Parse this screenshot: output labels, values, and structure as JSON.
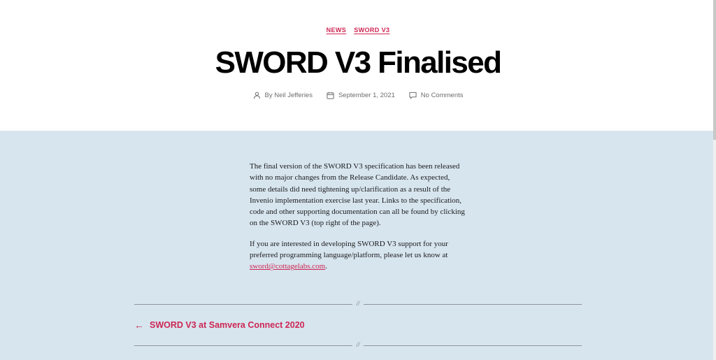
{
  "categories": [
    "NEWS",
    "SWORD V3"
  ],
  "title": "SWORD V3 Finalised",
  "meta": {
    "author": "By Neil Jefferies",
    "date": "September 1, 2021",
    "comments": "No Comments"
  },
  "body": {
    "paragraph1": "The final version of the SWORD V3 specification has been released with no major changes from the Release Candidate. As expected, some details did need tightening up/clarification as a result of the Invenio implementation exercise last year. Links to the specification, code and other supporting documentation can all be found by clicking on the SWORD V3 (top right of the page).",
    "paragraph2_text": "If you are interested in developing SWORD V3 support for your preferred programming language/platform, please let us know at ",
    "email": "sword@cottagelabs.com",
    "paragraph2_end": "."
  },
  "separator": "//",
  "navigation": {
    "previous_label": "SWORD V3 at Samvera Connect 2020",
    "previous_arrow": "←"
  },
  "colors": {
    "accent": "#cd2653",
    "content_bg": "#d7e5ef",
    "meta_text": "#6d6d6d"
  }
}
